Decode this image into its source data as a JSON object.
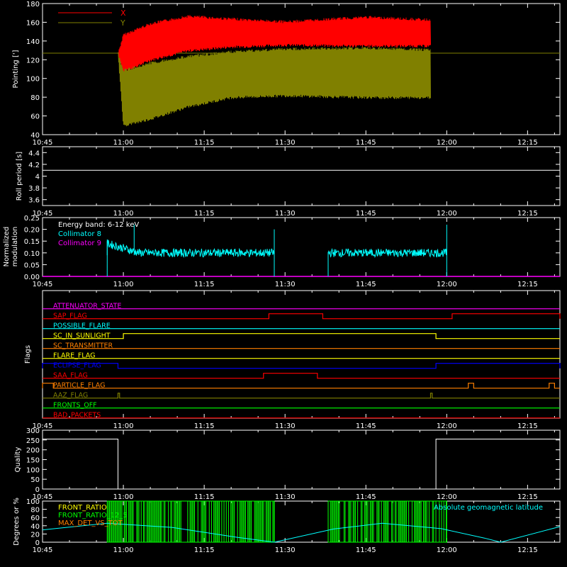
{
  "time_labels": [
    "10:45",
    "11:00",
    "11:15",
    "11:30",
    "11:45",
    "12:00",
    "12:15"
  ],
  "time_ticks_min": [
    0,
    15,
    30,
    45,
    60,
    75,
    90
  ],
  "chart_data": [
    {
      "type": "line",
      "panel": "pointing",
      "ylabel": "Pointing [']",
      "ylim": [
        40,
        180
      ],
      "yticks": [
        40,
        60,
        80,
        100,
        120,
        140,
        160,
        180
      ],
      "grid": false,
      "legend_position": "top-left",
      "constant_line": 127,
      "colors": {
        "X": "#ff0000",
        "Y": "#808000",
        "constant": "#808000"
      },
      "series": [
        {
          "name": "X",
          "x_start": "10:59",
          "x_end": "11:57",
          "envelope": [
            {
              "t": "10:59",
              "low": 125,
              "high": 128
            },
            {
              "t": "11:00",
              "low": 105,
              "high": 148
            },
            {
              "t": "11:05",
              "low": 118,
              "high": 160
            },
            {
              "t": "11:12",
              "low": 128,
              "high": 168
            },
            {
              "t": "11:20",
              "low": 132,
              "high": 165
            },
            {
              "t": "11:30",
              "low": 134,
              "high": 162
            },
            {
              "t": "11:45",
              "low": 133,
              "high": 167
            },
            {
              "t": "11:57",
              "low": 133,
              "high": 164
            }
          ]
        },
        {
          "name": "Y",
          "x_start": "10:59",
          "x_end": "11:57",
          "envelope": [
            {
              "t": "10:59",
              "low": 125,
              "high": 128
            },
            {
              "t": "11:00",
              "low": 48,
              "high": 110
            },
            {
              "t": "11:05",
              "low": 55,
              "high": 118
            },
            {
              "t": "11:12",
              "low": 68,
              "high": 125
            },
            {
              "t": "11:20",
              "low": 78,
              "high": 130
            },
            {
              "t": "11:30",
              "low": 80,
              "high": 133
            },
            {
              "t": "11:45",
              "low": 78,
              "high": 134
            },
            {
              "t": "11:57",
              "low": 78,
              "high": 132
            }
          ]
        }
      ]
    },
    {
      "type": "line",
      "panel": "roll",
      "ylabel": "Roll period [s]",
      "ylim": [
        3.5,
        4.5
      ],
      "yticks": [
        3.6,
        3.8,
        4.0,
        4.2,
        4.4
      ],
      "series": [
        {
          "x": [
            "10:45",
            "12:21"
          ],
          "values": [
            4.1,
            4.1
          ]
        }
      ]
    },
    {
      "type": "line",
      "panel": "modulation",
      "ylabel": "Normalized modulation",
      "ylim": [
        0,
        0.25
      ],
      "yticks": [
        "0.00",
        "0.05",
        "0.10",
        "0.15",
        "0.20",
        "0.25"
      ],
      "annotation": "Energy band: 6-12 keV",
      "colors": {
        "Collimator 8": "#00ffff",
        "Collimator 9": "#ff00ff"
      },
      "series": [
        {
          "name": "Collimator 8",
          "segments": [
            {
              "from": "10:57",
              "to": "11:28",
              "start_level": 0.14,
              "end_level": 0.1,
              "spikes": [
                [
                  "10:57",
                  0.15
                ],
                [
                  "11:02",
                  0.22
                ],
                [
                  "11:28",
                  0.2
                ]
              ]
            },
            {
              "from": "11:38",
              "to": "12:00",
              "start_level": 0.1,
              "end_level": 0.1,
              "spikes": [
                [
                  "12:00",
                  0.22
                ]
              ]
            }
          ]
        },
        {
          "name": "Collimator 9",
          "values": [
            0.0
          ]
        }
      ]
    },
    {
      "type": "step",
      "panel": "flags",
      "ylabel": "Flags",
      "flags": [
        {
          "name": "ATTENUATOR_STATE",
          "color": "#ff00ff",
          "highs": []
        },
        {
          "name": "SAP_FLAG",
          "color": "#ff0000",
          "highs": [
            [
              "11:27",
              "11:37"
            ],
            [
              "12:01",
              "12:21"
            ]
          ]
        },
        {
          "name": "POSSIBLE_FLARE",
          "color": "#00ffff",
          "highs": []
        },
        {
          "name": "SC_IN_SUNLIGHT",
          "color": "#ffff00",
          "highs": [
            [
              "11:00",
              "11:58"
            ]
          ]
        },
        {
          "name": "SC_TRANSMITTER",
          "color": "#ff8000",
          "highs": []
        },
        {
          "name": "FLARE_FLAG",
          "color": "#ffff00",
          "highs": []
        },
        {
          "name": "ECLIPSE_FLAG",
          "color": "#0000ff",
          "highs": [
            [
              "10:45",
              "10:59"
            ],
            [
              "11:58",
              "12:21"
            ]
          ]
        },
        {
          "name": "SAA_FLAG",
          "color": "#ff0000",
          "highs": [
            [
              "11:26",
              "11:36"
            ]
          ]
        },
        {
          "name": "PARTICLE_FLAG",
          "color": "#ff8000",
          "highs": [
            [
              "10:45",
              "10:47"
            ],
            [
              "12:04",
              "12:05"
            ],
            [
              "12:19",
              "12:20"
            ]
          ]
        },
        {
          "name": "AAZ_FLAG",
          "color": "#808000",
          "highs": [
            [
              "10:59",
              "10:59.3"
            ],
            [
              "11:57",
              "11:57.3"
            ]
          ]
        },
        {
          "name": "FRONTS_OFF",
          "color": "#00ff00",
          "highs": []
        },
        {
          "name": "BAD_PACKETS",
          "color": "#ff0000",
          "highs": []
        }
      ]
    },
    {
      "type": "step",
      "panel": "quality",
      "ylabel": "Quality",
      "ylim": [
        0,
        300
      ],
      "yticks": [
        0,
        50,
        100,
        150,
        200,
        250,
        300
      ],
      "series": [
        {
          "steps": [
            [
              "10:45",
              255
            ],
            [
              "10:59",
              0
            ],
            [
              "11:58",
              255
            ],
            [
              "12:21",
              255
            ]
          ]
        }
      ]
    },
    {
      "type": "line",
      "panel": "latitude",
      "ylabel": "Degrees or %",
      "ylim": [
        0,
        100
      ],
      "yticks": [
        0,
        20,
        40,
        60,
        80,
        100
      ],
      "legend": [
        "FRONT_RATIO",
        "FRONT_RATIO_12_5",
        "MAX_DET_VS_TOT"
      ],
      "legend_colors": [
        "#ffff00",
        "#00ff00",
        "#ff8000"
      ],
      "annotation_right": "Absolute geomagnetic latitude",
      "green_bands": [
        [
          "10:57",
          "11:28"
        ],
        [
          "11:38",
          "12:00"
        ]
      ],
      "series": [
        {
          "name": "Absolute geomagnetic latitude",
          "color": "#00ffff",
          "points": [
            [
              "10:45",
              30
            ],
            [
              "10:57",
              46
            ],
            [
              "11:09",
              36
            ],
            [
              "11:21",
              12
            ],
            [
              "11:28",
              0
            ],
            [
              "11:39",
              32
            ],
            [
              "11:48",
              46
            ],
            [
              "11:59",
              33
            ],
            [
              "12:07",
              10
            ],
            [
              "12:10",
              0
            ],
            [
              "12:21",
              38
            ]
          ]
        }
      ]
    }
  ]
}
